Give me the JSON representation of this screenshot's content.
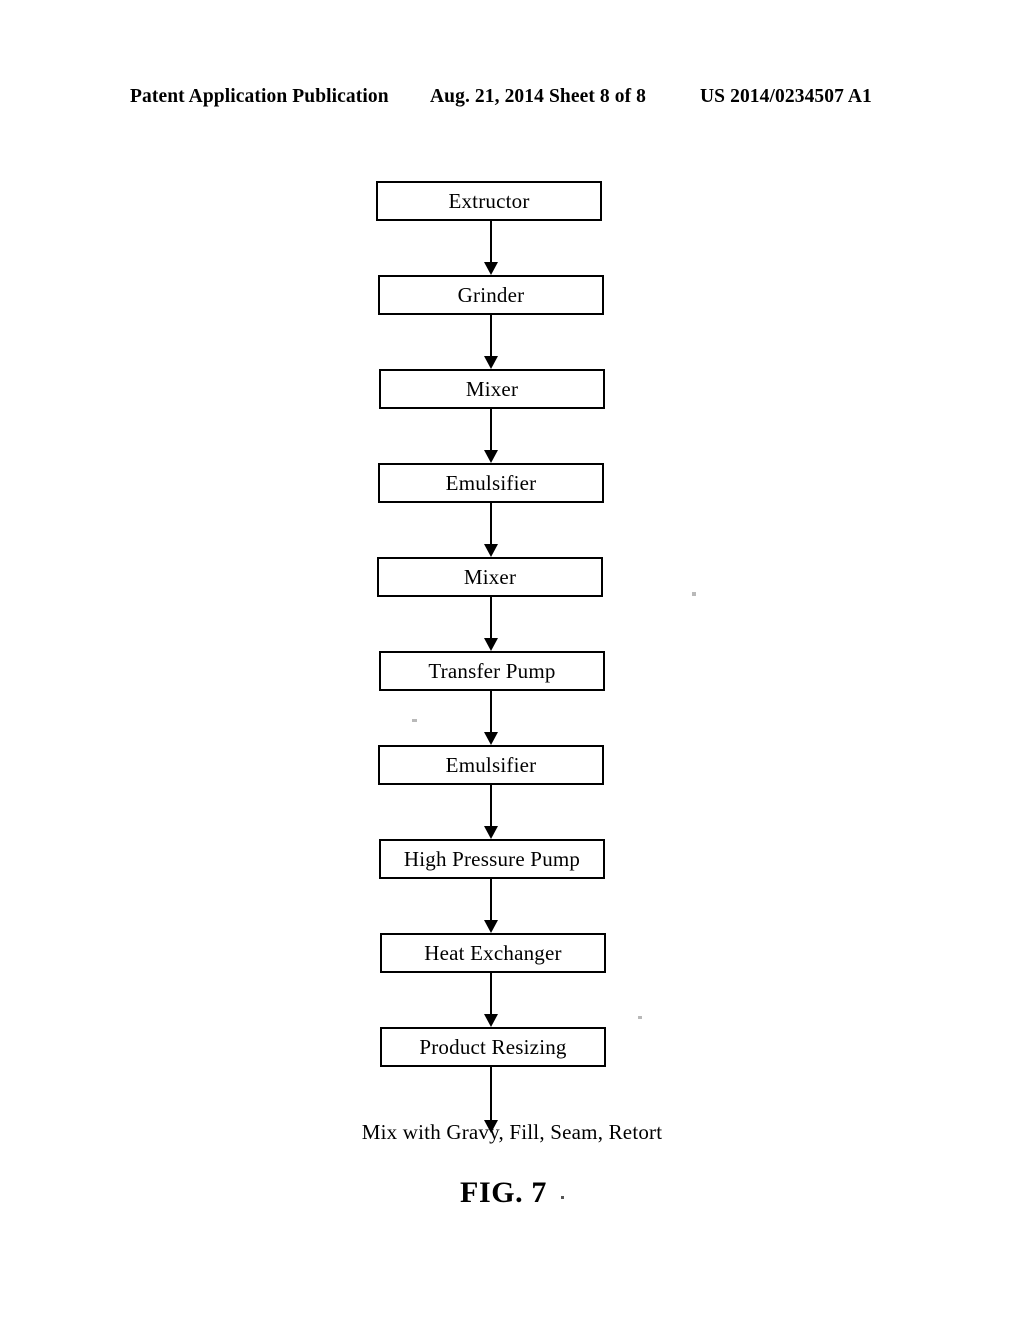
{
  "header": {
    "left": "Patent Application Publication",
    "center": "Aug. 21, 2014  Sheet 8 of 8",
    "right": "US 2014/0234507 A1"
  },
  "figure": {
    "caption": "FIG. 7",
    "terminal_text": "Mix with Gravy, Fill, Seam, Retort"
  },
  "flowchart": {
    "type": "process-flow",
    "orientation": "top-to-bottom",
    "connector": "arrow-down",
    "steps": [
      {
        "label": "Extructor"
      },
      {
        "label": "Grinder"
      },
      {
        "label": "Mixer"
      },
      {
        "label": "Emulsifier"
      },
      {
        "label": "Mixer"
      },
      {
        "label": "Transfer Pump"
      },
      {
        "label": "Emulsifier"
      },
      {
        "label": "High Pressure Pump"
      },
      {
        "label": "Heat Exchanger"
      },
      {
        "label": "Product Resizing"
      }
    ]
  },
  "colors": {
    "ink": "#000000",
    "paper": "#ffffff"
  }
}
